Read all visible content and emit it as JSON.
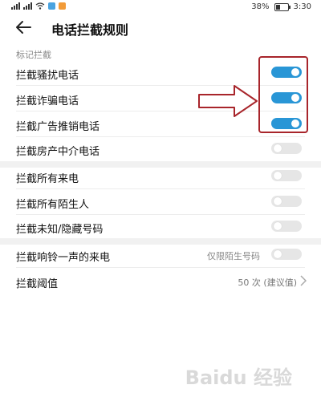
{
  "status_bar": {
    "battery": "38%",
    "time": "3:30"
  },
  "header": {
    "title": "电话拦截规则"
  },
  "section": {
    "label": "标记拦截"
  },
  "rows": [
    {
      "label": "拦截骚扰电话",
      "toggle": true
    },
    {
      "label": "拦截诈骗电话",
      "toggle": true
    },
    {
      "label": "拦截广告推销电话",
      "toggle": true
    },
    {
      "label": "拦截房产中介电话",
      "toggle": false
    },
    {
      "label": "拦截所有来电",
      "toggle": false
    },
    {
      "label": "拦截所有陌生人",
      "toggle": false
    },
    {
      "label": "拦截未知/隐藏号码",
      "toggle": false
    },
    {
      "label": "拦截响铃一声的来电",
      "sub": "仅限陌生号码",
      "toggle": false
    },
    {
      "label": "拦截阈值",
      "value": "50 次 (建议值)"
    }
  ],
  "watermark": "Baidu 经验",
  "colors": {
    "toggle_on": "#2996d6",
    "toggle_off": "#e6e6e6",
    "annotation": "#a8252b"
  }
}
